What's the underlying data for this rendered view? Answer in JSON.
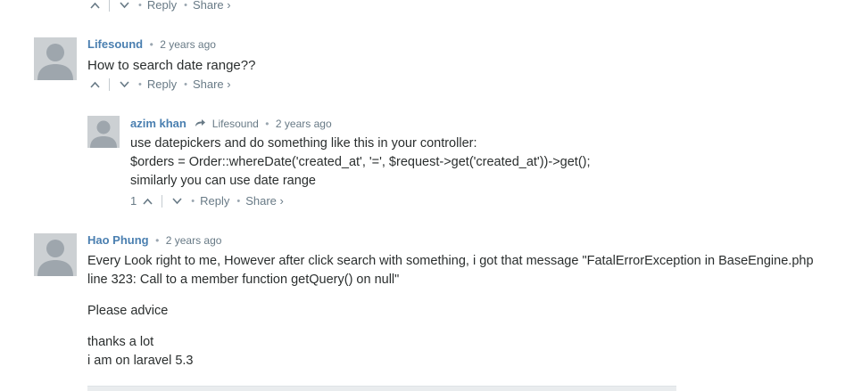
{
  "top_actions": {
    "reply": "Reply",
    "share": "Share ›"
  },
  "comments": [
    {
      "author": "Lifesound",
      "time": "2 years ago",
      "lines": [
        "How to search date range??"
      ],
      "reply": "Reply",
      "share": "Share ›"
    },
    {
      "author": "azim khan",
      "reply_to": "Lifesound",
      "time": "2 years ago",
      "lines": [
        "use datepickers and do something like this in your controller:",
        "$orders = Order::whereDate('created_at', '=', $request->get('created_at'))->get();",
        "similarly you can use date range"
      ],
      "votes": "1",
      "reply": "Reply",
      "share": "Share ›"
    },
    {
      "author": "Hao Phung",
      "time": "2 years ago",
      "lines": [
        "Every Look right to me, However after click search with something, i got that message \"FatalErrorException in BaseEngine.php",
        "line 323: Call to a member function getQuery() on null\"",
        "Please advice",
        "thanks a lot",
        "i am on laravel 5.3"
      ]
    }
  ],
  "icons": {
    "upvote": "chevron-up-icon",
    "downvote": "chevron-down-icon",
    "reply_arrow": "reply-arrow-icon",
    "avatar": "default-avatar-icon"
  },
  "colors": {
    "author": "#4a7fb0",
    "meta": "#687a86",
    "text": "#2a2e2e",
    "avatar_bg": "#ccd0d3",
    "avatar_fg": "#9ea6ad"
  }
}
